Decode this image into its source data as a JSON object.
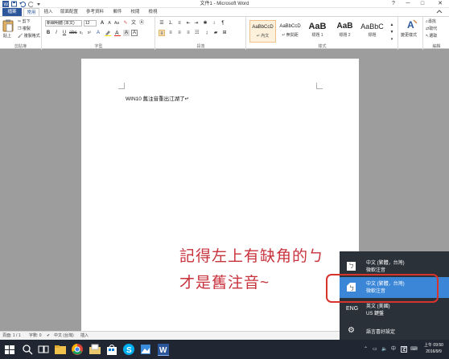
{
  "window": {
    "title": "文件1 - Microsoft Word",
    "help_icon": "?",
    "minimize_icon": "─",
    "maximize_icon": "□",
    "close_icon": "✕"
  },
  "quick_access": {
    "save_icon": "save-icon",
    "undo_icon": "undo-icon",
    "redo_icon": "redo-icon"
  },
  "tabs": [
    "檔案",
    "常用",
    "插入",
    "版面配置",
    "參考資料",
    "郵件",
    "校閱",
    "檢視"
  ],
  "ribbon": {
    "clipboard": {
      "label": "剪貼簿",
      "paste": "貼上",
      "cut": "剪下",
      "copy": "複製",
      "format_painter": "複製格式"
    },
    "font": {
      "label": "字型",
      "font_name": "新細明體 (本文)",
      "font_size": "12"
    },
    "paragraph": {
      "label": "段落"
    },
    "styles": {
      "label": "樣式",
      "items": [
        {
          "sample": "AaBbCcD",
          "name": "↵ 內文"
        },
        {
          "sample": "AaBbCcD",
          "name": "↵ 無間距"
        },
        {
          "sample": "AaB",
          "name": "標題 1"
        },
        {
          "sample": "AaB",
          "name": "標題 2"
        },
        {
          "sample": "AaBbC",
          "name": "標題"
        }
      ],
      "change_styles": "變更樣式"
    },
    "editing": {
      "label": "編輯",
      "find": "尋找",
      "replace": "取代",
      "select": "選取"
    }
  },
  "document": {
    "body_text": "WIN10 舊注音重出江湖了↵"
  },
  "annotation": {
    "line1": "記得左上有缺角的ㄅ",
    "line2": "才是舊注音~"
  },
  "statusbar": {
    "page": "頁面: 1 / 1",
    "words": "字數: 0",
    "language": "中文 (台灣)",
    "mode": "插入"
  },
  "language_flyout": {
    "items": [
      {
        "code": "",
        "line1": "中文 (繁體，台灣)",
        "line2": "微軟注音",
        "selected": false
      },
      {
        "code": "",
        "line1": "中文 (繁體，台灣)",
        "line2": "微軟注音",
        "selected": true
      },
      {
        "code": "ENG",
        "line1": "英文 (美國)",
        "line2": "US 鍵盤",
        "selected": false
      }
    ],
    "preferences": "語言喜好設定"
  },
  "taskbar": {
    "tray_lang": "中",
    "clock_time": "上午 09:50",
    "clock_date": "2016/9/9"
  },
  "colors": {
    "accent": "#2b579a",
    "annotation": "#c8323c",
    "flyout_selected": "#3b86d6"
  }
}
